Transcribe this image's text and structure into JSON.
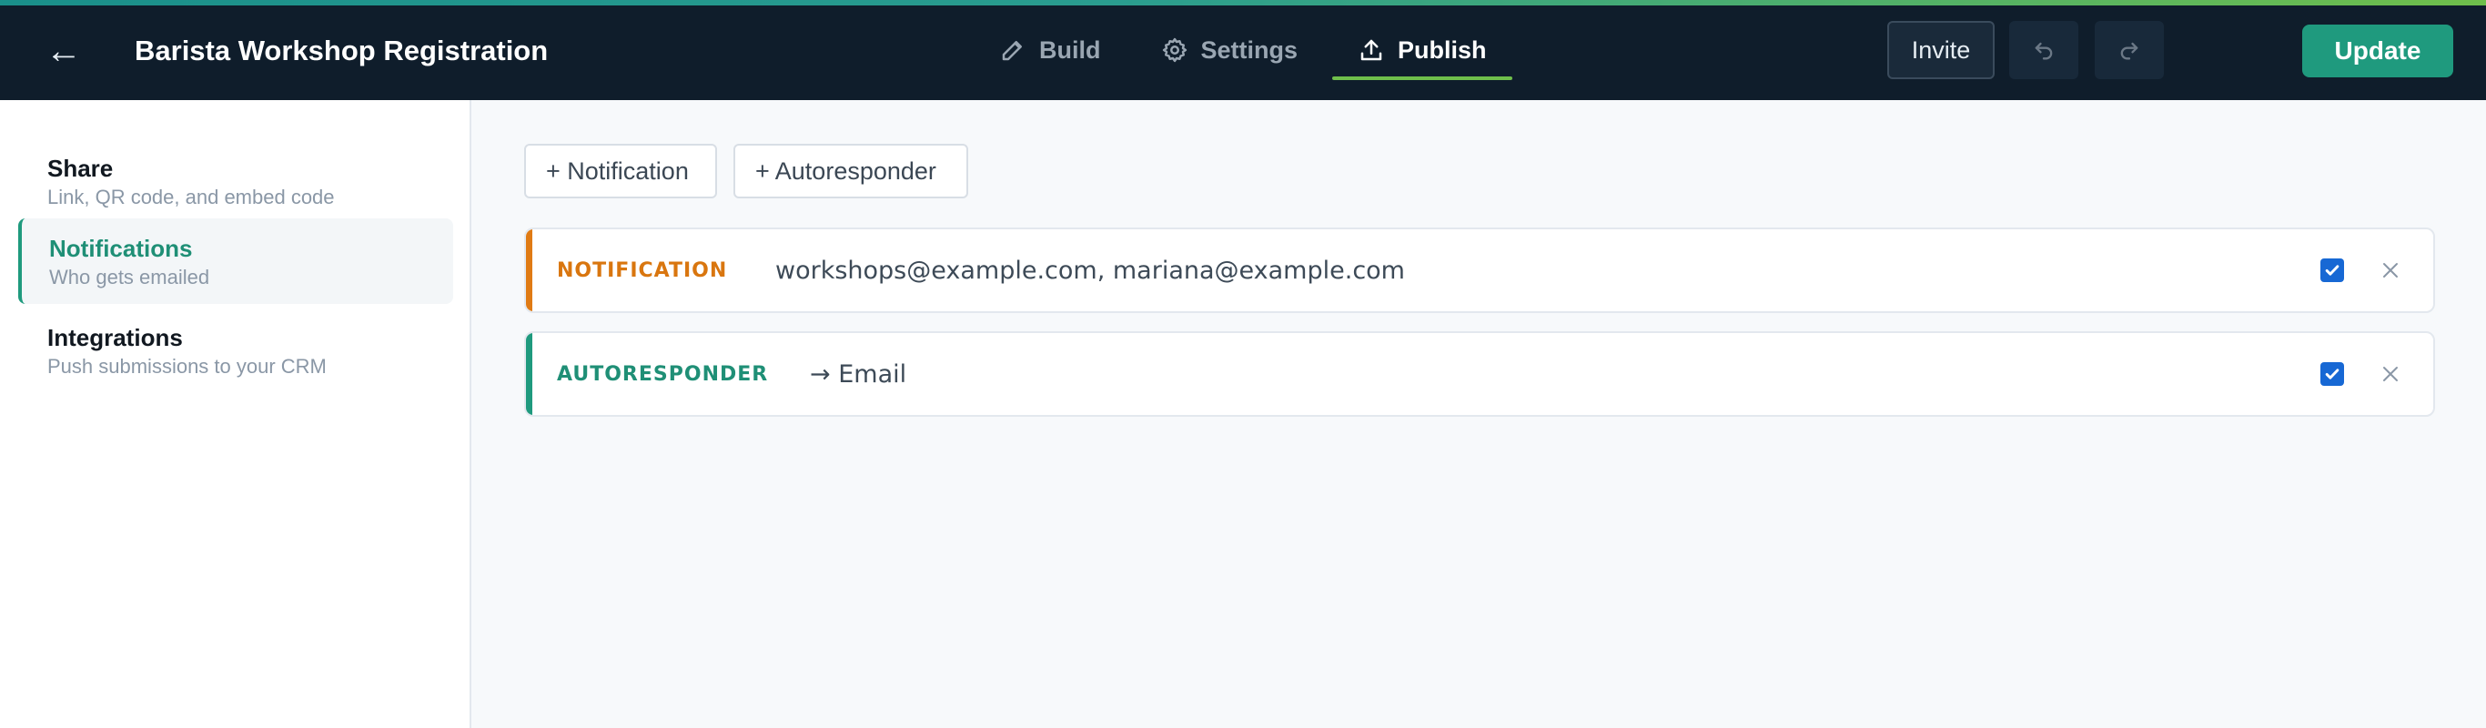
{
  "header": {
    "back_icon": "arrow-left-icon",
    "title": "Barista Workshop Registration",
    "tabs": [
      {
        "label": "Build",
        "icon": "pencil-icon",
        "active": false
      },
      {
        "label": "Settings",
        "icon": "gear-icon",
        "active": false
      },
      {
        "label": "Publish",
        "icon": "upload-icon",
        "active": true
      }
    ],
    "invite_label": "Invite",
    "undo_icon": "undo-icon",
    "redo_icon": "redo-icon",
    "update_label": "Update"
  },
  "sidebar": {
    "items": [
      {
        "label": "Share",
        "desc": "Link, QR code, and embed code",
        "active": false
      },
      {
        "label": "Notifications",
        "desc": "Who gets emailed",
        "active": true
      },
      {
        "label": "Integrations",
        "desc": "Push submissions to your CRM",
        "active": false
      }
    ]
  },
  "main": {
    "add_notification_label": "+ Notification",
    "add_autoresponder_label": "+ Autoresponder",
    "cards": [
      {
        "type": "NOTIFICATION",
        "detail": "workshops@example.com, mariana@example.com",
        "enabled": true,
        "accent": "#e07b14"
      },
      {
        "type": "AUTORESPONDER",
        "detail": "→ Email",
        "enabled": true,
        "accent": "#1f9a7e"
      }
    ]
  },
  "colors": {
    "topbar_bg": "#0f1d2b",
    "brand_green": "#1f9a7e",
    "notification_orange": "#e07b14",
    "checkbox_blue": "#1768d4"
  }
}
